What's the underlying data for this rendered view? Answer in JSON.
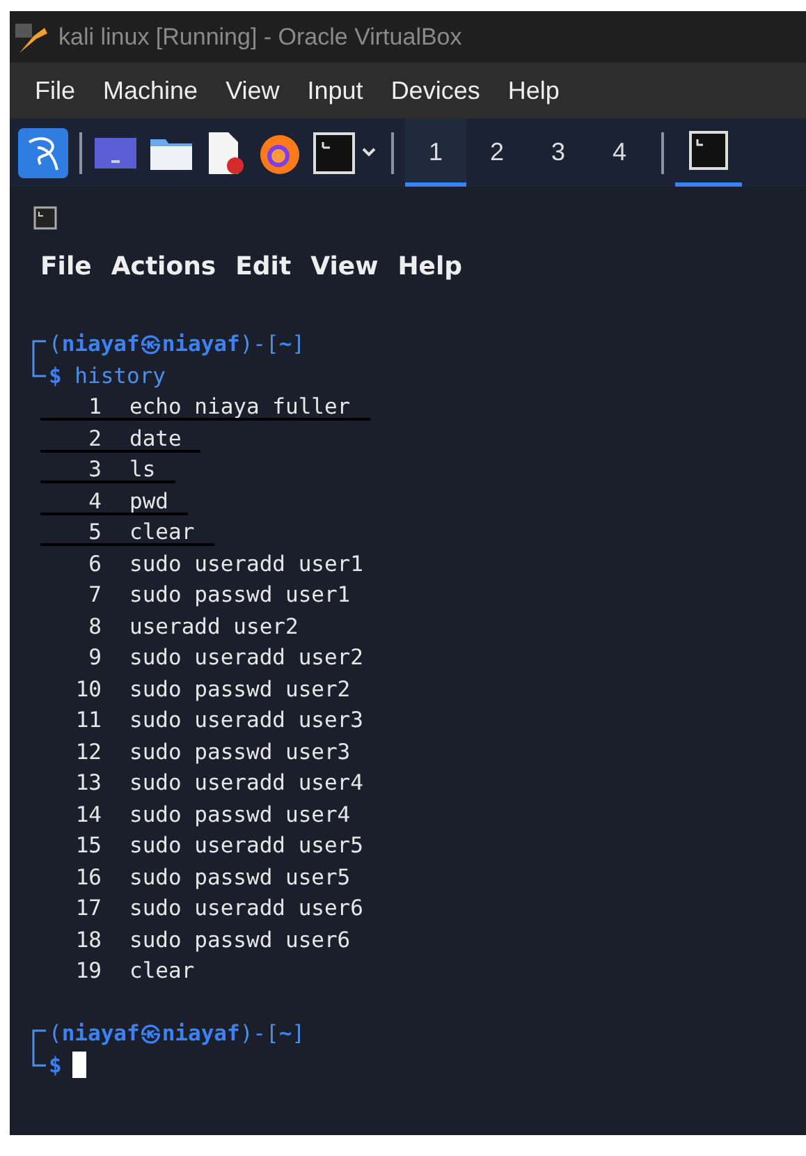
{
  "window": {
    "title": "kali linux [Running] - Oracle VirtualBox"
  },
  "menu": [
    "File",
    "Machine",
    "View",
    "Input",
    "Devices",
    "Help"
  ],
  "panel": {
    "launchers": [
      {
        "kind": "kali"
      },
      {
        "kind": "desktop"
      },
      {
        "kind": "folder"
      },
      {
        "kind": "editor"
      },
      {
        "kind": "firefox"
      },
      {
        "kind": "terminal"
      }
    ],
    "workspaces": [
      {
        "label": "1",
        "selected": true
      },
      {
        "label": "2",
        "selected": false
      },
      {
        "label": "3",
        "selected": false
      },
      {
        "label": "4",
        "selected": false
      }
    ],
    "tasks": [
      {
        "kind": "terminal",
        "selected": true
      }
    ]
  },
  "terminal": {
    "menu": [
      "File",
      "Actions",
      "Edit",
      "View",
      "Help"
    ],
    "prompt": {
      "text": "(**niayaf㉿niayaf**)-[**~**]",
      "symbol": "$",
      "command": "history"
    },
    "history": [
      {
        "num": "1",
        "cmd": "echo niaya fuller",
        "struck": true
      },
      {
        "num": "2",
        "cmd": "date",
        "struck": true
      },
      {
        "num": "3",
        "cmd": "ls",
        "struck": true
      },
      {
        "num": "4",
        "cmd": "pwd",
        "struck": true
      },
      {
        "num": "5",
        "cmd": "clear",
        "struck": true
      },
      {
        "num": "6",
        "cmd": "sudo useradd user1",
        "struck": false
      },
      {
        "num": "7",
        "cmd": "sudo passwd user1",
        "struck": false
      },
      {
        "num": "8",
        "cmd": "useradd user2",
        "struck": false
      },
      {
        "num": "9",
        "cmd": "sudo useradd user2",
        "struck": false
      },
      {
        "num": "10",
        "cmd": "sudo passwd user2",
        "struck": false
      },
      {
        "num": "11",
        "cmd": "sudo useradd user3",
        "struck": false
      },
      {
        "num": "12",
        "cmd": "sudo passwd user3",
        "struck": false
      },
      {
        "num": "13",
        "cmd": "sudo useradd user4",
        "struck": false
      },
      {
        "num": "14",
        "cmd": "sudo passwd user4",
        "struck": false
      },
      {
        "num": "15",
        "cmd": "sudo useradd user5",
        "struck": false
      },
      {
        "num": "16",
        "cmd": "sudo passwd user5",
        "struck": false
      },
      {
        "num": "17",
        "cmd": "sudo useradd user6",
        "struck": false
      },
      {
        "num": "18",
        "cmd": "sudo passwd user6",
        "struck": false
      },
      {
        "num": "19",
        "cmd": "clear",
        "struck": false
      }
    ],
    "prompt2": {
      "text": "(**niayaf㉿niayaf**)-[**~**]",
      "symbol": "$"
    }
  }
}
